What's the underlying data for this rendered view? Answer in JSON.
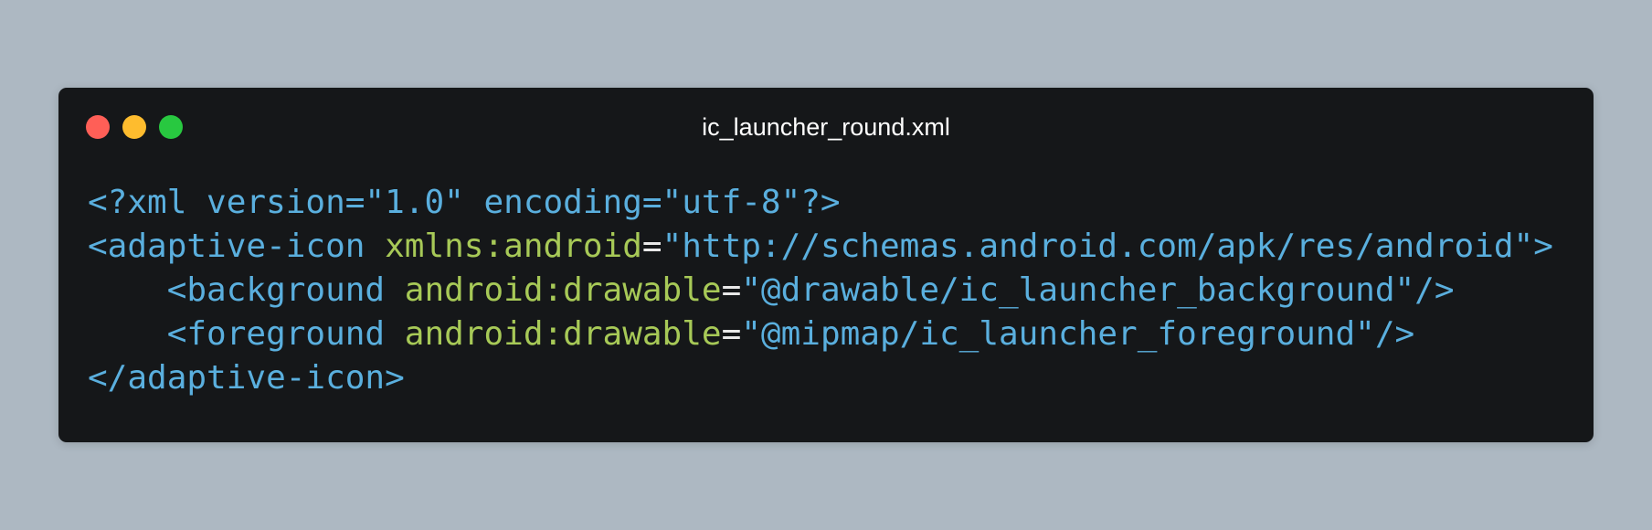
{
  "window": {
    "title": "ic_launcher_round.xml",
    "controls": [
      "close",
      "minimize",
      "maximize"
    ]
  },
  "colors": {
    "background": "#adb8c2",
    "window": "#151719",
    "tag": "#5aafde",
    "attribute": "#a7c957",
    "equals": "#e8e8e8",
    "close": "#ff5f57",
    "minimize": "#febc2e",
    "maximize": "#28c840"
  },
  "code": {
    "line1": {
      "text": "<?xml version=\"1.0\" encoding=\"utf-8\"?>"
    },
    "line2": {
      "open": "<adaptive-icon ",
      "attr": "xmlns:android",
      "eq": "=",
      "value": "\"http://schemas.android.com/apk/res/android\">"
    },
    "line3": {
      "open": "    <background ",
      "attr": "android:drawable",
      "eq": "=",
      "value": "\"@drawable/ic_launcher_background\"/>"
    },
    "line4": {
      "open": "    <foreground ",
      "attr": "android:drawable",
      "eq": "=",
      "value": "\"@mipmap/ic_launcher_foreground\"/>"
    },
    "line5": {
      "text": "</adaptive-icon>"
    }
  }
}
